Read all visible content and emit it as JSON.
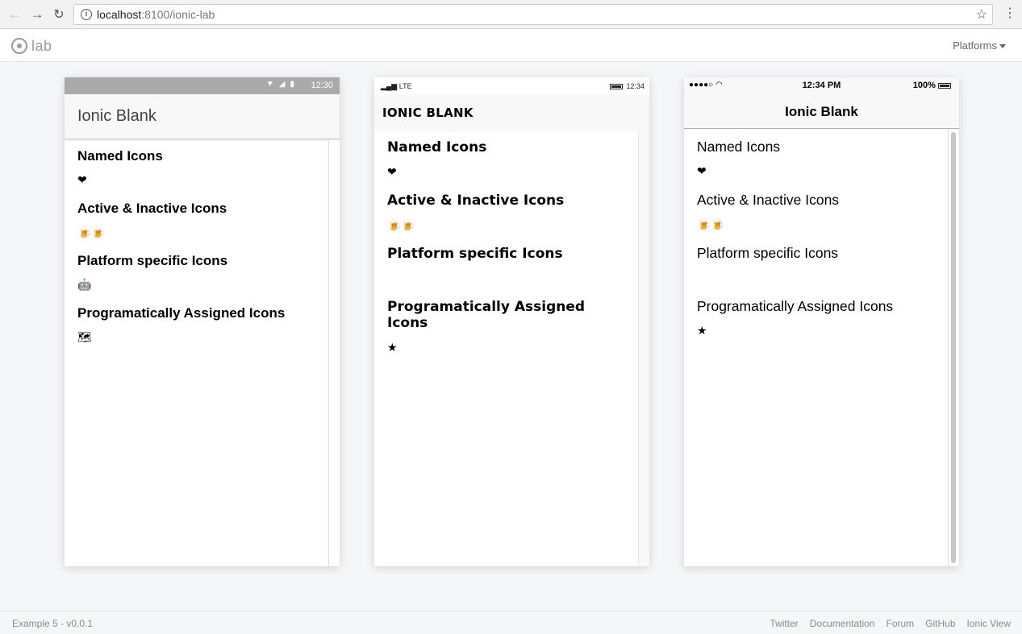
{
  "browser": {
    "url_host": "localhost",
    "url_rest": ":8100/ionic-lab"
  },
  "lab": {
    "logo_text": "lab",
    "platforms_label": "Platforms"
  },
  "android": {
    "time": "12:30",
    "title": "Ionic Blank",
    "sections": [
      {
        "title": "Named Icons",
        "icons": "❤"
      },
      {
        "title": "Active & Inactive Icons",
        "icons": "🍺🍺"
      },
      {
        "title": "Platform specific Icons",
        "icons": "🤖"
      },
      {
        "title": "Programatically Assigned Icons",
        "icons": "🗺"
      }
    ]
  },
  "windows": {
    "network": "LTE",
    "time": "12:34",
    "title": "IONIC BLANK",
    "sections": [
      {
        "title": "Named Icons",
        "icons": "❤"
      },
      {
        "title": "Active & Inactive Icons",
        "icons": "🍺🍺"
      },
      {
        "title": "Platform specific Icons",
        "icons": ""
      },
      {
        "title": "Programatically Assigned Icons",
        "icons": "★"
      }
    ]
  },
  "ios": {
    "signal": "●●●●○",
    "time": "12:34 PM",
    "battery": "100%",
    "title": "Ionic Blank",
    "sections": [
      {
        "title": "Named Icons",
        "icons": "❤"
      },
      {
        "title": "Active & Inactive Icons",
        "icons": "🍺🍺"
      },
      {
        "title": "Platform specific Icons",
        "icons": ""
      },
      {
        "title": "Programatically Assigned Icons",
        "icons": "★"
      }
    ]
  },
  "footer": {
    "version": "Example 5 - v0.0.1",
    "links": [
      "Twitter",
      "Documentation",
      "Forum",
      "GitHub",
      "Ionic View"
    ]
  }
}
